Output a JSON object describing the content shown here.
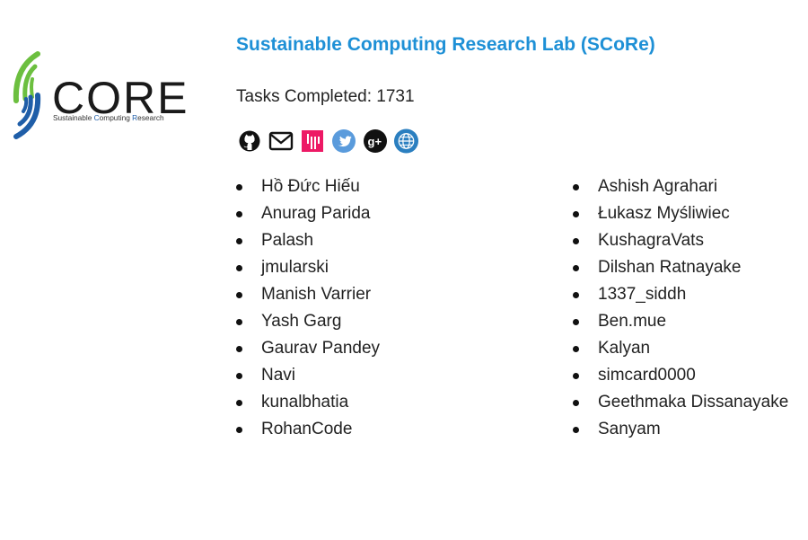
{
  "logo": {
    "wordmark": "CORE",
    "tagline_parts": [
      "Sustainable ",
      "C",
      "omputing ",
      "R",
      "esearch"
    ]
  },
  "header": {
    "title": "Sustainable Computing Research Lab (SCoRe)",
    "tasks_completed": "Tasks Completed: 1731"
  },
  "social_icons": [
    "github-icon",
    "email-icon",
    "gitter-icon",
    "twitter-icon",
    "google-plus-icon",
    "website-icon"
  ],
  "members": {
    "left": [
      "Hồ Đức Hiếu",
      "Anurag Parida",
      "Palash",
      "jmularski",
      "Manish Varrier",
      "Yash Garg",
      "Gaurav Pandey",
      "Navi",
      "kunalbhatia",
      "RohanCode"
    ],
    "right": [
      "Ashish Agrahari",
      "Łukasz Myśliwiec",
      "KushagraVats",
      "Dilshan Ratnayake",
      "1337_siddh",
      "Ben.mue",
      "Kalyan",
      "simcard0000",
      "Geethmaka Dissanayake",
      "Sanyam"
    ]
  },
  "colors": {
    "title": "#1e90d6",
    "logo_green": "#6cbf3f",
    "logo_blue": "#1f5ea8",
    "gitter": "#ed1965",
    "twitter": "#5a9bdc",
    "website": "#2b7fc0"
  }
}
